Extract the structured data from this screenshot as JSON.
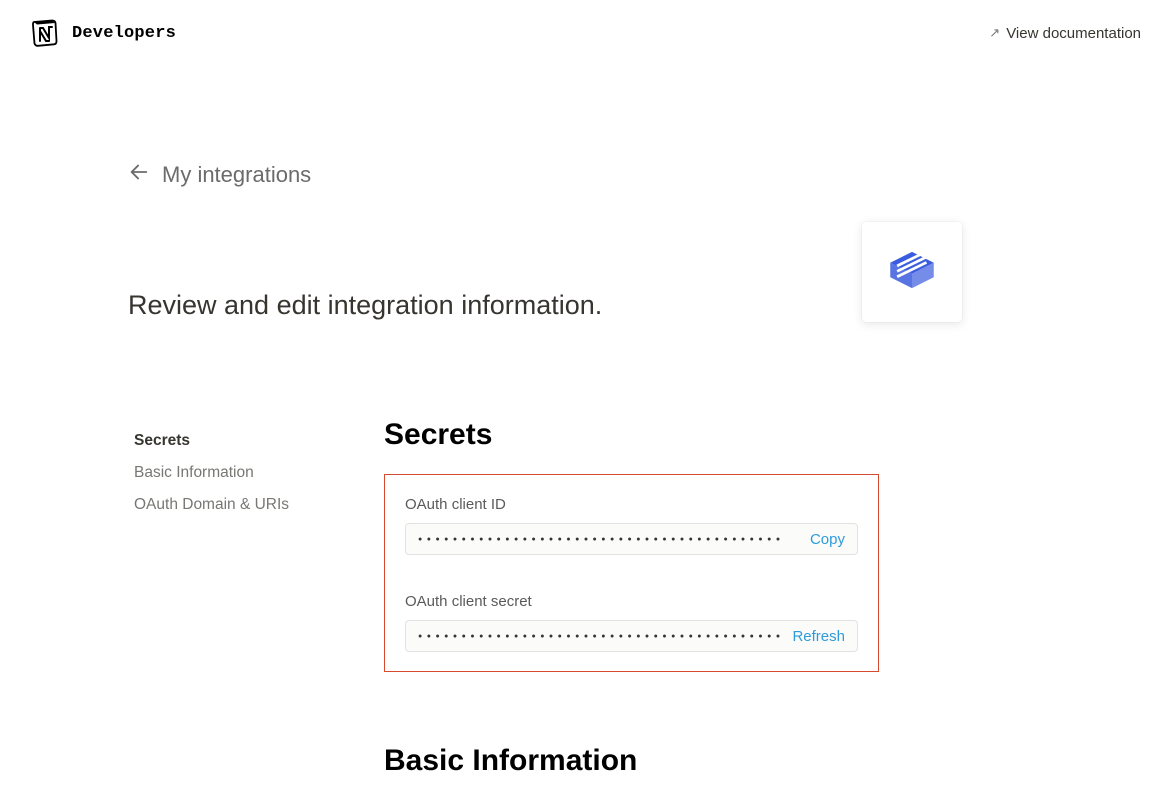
{
  "header": {
    "brand": "Developers",
    "doc_link": "View documentation"
  },
  "breadcrumb": {
    "label": "My integrations"
  },
  "subtitle": "Review and edit integration information.",
  "sidebar": {
    "items": [
      {
        "label": "Secrets",
        "active": true
      },
      {
        "label": "Basic Information",
        "active": false
      },
      {
        "label": "OAuth Domain & URIs",
        "active": false
      }
    ]
  },
  "sections": {
    "secrets": {
      "title": "Secrets",
      "client_id": {
        "label": "OAuth client ID",
        "masked": "●●●●●●●●●●●●●●●●●●●●●●●●●●●●●●●●●●●●●●●●●●",
        "action": "Copy"
      },
      "client_secret": {
        "label": "OAuth client secret",
        "masked": "●●●●●●●●●●●●●●●●●●●●●●●●●●●●●●●●●●●●●●●●●●",
        "action": "Refresh"
      }
    },
    "basic_info": {
      "title": "Basic Information"
    }
  }
}
